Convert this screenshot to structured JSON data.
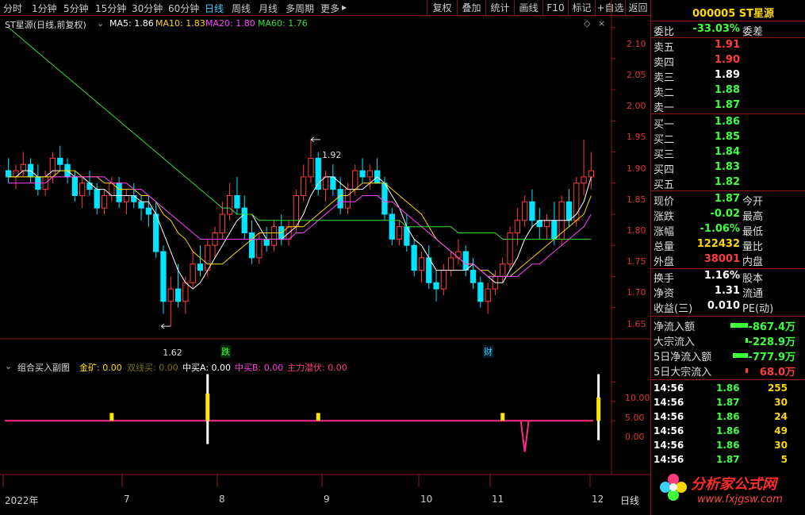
{
  "toolbar": {
    "timeframes": [
      "分时",
      "1分钟",
      "5分钟",
      "15分钟",
      "30分钟",
      "60分钟",
      "日线",
      "周线",
      "月线",
      "多周期",
      "更多"
    ],
    "active_timeframe": "日线",
    "more_arrow": "▸",
    "buttons": [
      "复权",
      "叠加",
      "统计",
      "画线",
      "F10",
      "标记",
      "+自选",
      "返回"
    ]
  },
  "main_legend": {
    "title": "ST星源(日线,前复权)",
    "ma5": "MA5: 1.86",
    "ma10": "MA10: 1.83",
    "ma20": "MA20: 1.80",
    "ma60": "MA60: 1.76",
    "ma5_color": "#ffffff",
    "ma10_color": "#ffd700",
    "ma20_color": "#ff44ff",
    "ma60_color": "#33dd33"
  },
  "annotations": {
    "high": "1.92",
    "low": "1.62",
    "mark_die": "跌",
    "mark_cai": "财"
  },
  "sub_legend": {
    "title": "组合买入副图",
    "jinkuang_label": "金矿: ",
    "jinkuang_value": "0.00",
    "shuangxian_label": "双线买: ",
    "shuangxian_value": "0.00",
    "zhongmai_a_label": "中买A: ",
    "zhongmai_a_value": "0.00",
    "zhongmai_b_label": "中买B: ",
    "zhongmai_b_value": "0.00",
    "zhuli_label": "主力潜伏: ",
    "zhuli_value": "0.00"
  },
  "x_axis": [
    "2022年",
    "7",
    "8",
    "9",
    "10",
    "11",
    "12"
  ],
  "period_label": "日线",
  "chart_data": [
    {
      "type": "candlestick",
      "title": "ST星源(日线,前复权)",
      "ylim": [
        1.61,
        2.12
      ],
      "yticks": [
        "2.10",
        "2.05",
        "2.00",
        "1.95",
        "1.90",
        "1.85",
        "1.80",
        "1.75",
        "1.70",
        "1.65"
      ],
      "ytick_values": [
        2.1,
        2.05,
        2.0,
        1.95,
        1.9,
        1.85,
        1.8,
        1.75,
        1.7,
        1.65
      ],
      "candles": [
        [
          1.87,
          1.89,
          1.85,
          1.86
        ],
        [
          1.86,
          1.88,
          1.84,
          1.87
        ],
        [
          1.87,
          1.9,
          1.86,
          1.88
        ],
        [
          1.88,
          1.89,
          1.85,
          1.86
        ],
        [
          1.86,
          1.88,
          1.83,
          1.84
        ],
        [
          1.84,
          1.87,
          1.83,
          1.86
        ],
        [
          1.86,
          1.9,
          1.85,
          1.89
        ],
        [
          1.89,
          1.91,
          1.87,
          1.88
        ],
        [
          1.88,
          1.89,
          1.85,
          1.86
        ],
        [
          1.86,
          1.87,
          1.82,
          1.83
        ],
        [
          1.83,
          1.86,
          1.81,
          1.85
        ],
        [
          1.85,
          1.87,
          1.83,
          1.84
        ],
        [
          1.84,
          1.85,
          1.8,
          1.81
        ],
        [
          1.81,
          1.84,
          1.8,
          1.83
        ],
        [
          1.83,
          1.86,
          1.82,
          1.85
        ],
        [
          1.85,
          1.86,
          1.81,
          1.82
        ],
        [
          1.82,
          1.84,
          1.8,
          1.83
        ],
        [
          1.83,
          1.85,
          1.81,
          1.82
        ],
        [
          1.82,
          1.83,
          1.79,
          1.81
        ],
        [
          1.81,
          1.83,
          1.78,
          1.8
        ],
        [
          1.8,
          1.82,
          1.73,
          1.74
        ],
        [
          1.74,
          1.75,
          1.64,
          1.66
        ],
        [
          1.66,
          1.7,
          1.62,
          1.68
        ],
        [
          1.68,
          1.72,
          1.65,
          1.66
        ],
        [
          1.66,
          1.7,
          1.64,
          1.69
        ],
        [
          1.69,
          1.74,
          1.68,
          1.72
        ],
        [
          1.72,
          1.75,
          1.7,
          1.71
        ],
        [
          1.71,
          1.76,
          1.7,
          1.75
        ],
        [
          1.75,
          1.78,
          1.73,
          1.77
        ],
        [
          1.77,
          1.82,
          1.76,
          1.8
        ],
        [
          1.8,
          1.85,
          1.79,
          1.83
        ],
        [
          1.83,
          1.86,
          1.8,
          1.81
        ],
        [
          1.81,
          1.83,
          1.76,
          1.77
        ],
        [
          1.77,
          1.79,
          1.72,
          1.73
        ],
        [
          1.73,
          1.77,
          1.72,
          1.76
        ],
        [
          1.76,
          1.78,
          1.74,
          1.75
        ],
        [
          1.75,
          1.79,
          1.74,
          1.78
        ],
        [
          1.78,
          1.8,
          1.75,
          1.76
        ],
        [
          1.76,
          1.79,
          1.75,
          1.78
        ],
        [
          1.78,
          1.84,
          1.77,
          1.83
        ],
        [
          1.83,
          1.88,
          1.82,
          1.86
        ],
        [
          1.86,
          1.92,
          1.85,
          1.89
        ],
        [
          1.89,
          1.9,
          1.83,
          1.84
        ],
        [
          1.84,
          1.87,
          1.82,
          1.86
        ],
        [
          1.86,
          1.88,
          1.83,
          1.84
        ],
        [
          1.84,
          1.86,
          1.8,
          1.81
        ],
        [
          1.81,
          1.85,
          1.8,
          1.84
        ],
        [
          1.84,
          1.88,
          1.83,
          1.87
        ],
        [
          1.87,
          1.89,
          1.85,
          1.86
        ],
        [
          1.86,
          1.88,
          1.84,
          1.87
        ],
        [
          1.87,
          1.89,
          1.85,
          1.85
        ],
        [
          1.85,
          1.86,
          1.79,
          1.8
        ],
        [
          1.8,
          1.81,
          1.75,
          1.76
        ],
        [
          1.76,
          1.79,
          1.75,
          1.78
        ],
        [
          1.78,
          1.8,
          1.74,
          1.75
        ],
        [
          1.75,
          1.76,
          1.7,
          1.71
        ],
        [
          1.71,
          1.74,
          1.69,
          1.73
        ],
        [
          1.73,
          1.75,
          1.68,
          1.69
        ],
        [
          1.69,
          1.71,
          1.66,
          1.68
        ],
        [
          1.68,
          1.72,
          1.67,
          1.71
        ],
        [
          1.71,
          1.74,
          1.7,
          1.73
        ],
        [
          1.73,
          1.76,
          1.72,
          1.74
        ],
        [
          1.74,
          1.75,
          1.7,
          1.71
        ],
        [
          1.71,
          1.73,
          1.68,
          1.69
        ],
        [
          1.69,
          1.7,
          1.65,
          1.66
        ],
        [
          1.66,
          1.69,
          1.64,
          1.68
        ],
        [
          1.68,
          1.71,
          1.67,
          1.7
        ],
        [
          1.7,
          1.73,
          1.69,
          1.72
        ],
        [
          1.72,
          1.78,
          1.71,
          1.77
        ],
        [
          1.77,
          1.81,
          1.75,
          1.79
        ],
        [
          1.79,
          1.83,
          1.78,
          1.82
        ],
        [
          1.82,
          1.84,
          1.78,
          1.79
        ],
        [
          1.79,
          1.81,
          1.76,
          1.78
        ],
        [
          1.78,
          1.8,
          1.76,
          1.79
        ],
        [
          1.79,
          1.82,
          1.75,
          1.76
        ],
        [
          1.76,
          1.83,
          1.75,
          1.82
        ],
        [
          1.82,
          1.84,
          1.78,
          1.79
        ],
        [
          1.79,
          1.86,
          1.78,
          1.85
        ],
        [
          1.85,
          1.92,
          1.83,
          1.86
        ],
        [
          1.86,
          1.9,
          1.84,
          1.87
        ]
      ],
      "series": [
        {
          "name": "MA5",
          "values": [
            1.86,
            1.86,
            1.87,
            1.87,
            1.86,
            1.86,
            1.87,
            1.87,
            1.87,
            1.86,
            1.86,
            1.85,
            1.84,
            1.84,
            1.83,
            1.83,
            1.83,
            1.83,
            1.82,
            1.82,
            1.8,
            1.77,
            1.74,
            1.71,
            1.69,
            1.68,
            1.69,
            1.71,
            1.73,
            1.75,
            1.77,
            1.79,
            1.8,
            1.8,
            1.78,
            1.76,
            1.76,
            1.76,
            1.77,
            1.78,
            1.8,
            1.83,
            1.85,
            1.86,
            1.86,
            1.85,
            1.84,
            1.84,
            1.84,
            1.85,
            1.86,
            1.85,
            1.83,
            1.81,
            1.78,
            1.76,
            1.75,
            1.73,
            1.71,
            1.71,
            1.71,
            1.71,
            1.71,
            1.72,
            1.71,
            1.7,
            1.69,
            1.69,
            1.71,
            1.73,
            1.76,
            1.78,
            1.79,
            1.79,
            1.79,
            1.79,
            1.79,
            1.8,
            1.82,
            1.86
          ]
        },
        {
          "name": "MA10",
          "values": [
            1.86,
            1.86,
            1.86,
            1.86,
            1.86,
            1.86,
            1.86,
            1.87,
            1.87,
            1.87,
            1.86,
            1.86,
            1.86,
            1.85,
            1.85,
            1.84,
            1.84,
            1.84,
            1.83,
            1.83,
            1.82,
            1.8,
            1.79,
            1.77,
            1.76,
            1.74,
            1.73,
            1.72,
            1.72,
            1.72,
            1.73,
            1.74,
            1.75,
            1.76,
            1.77,
            1.77,
            1.77,
            1.77,
            1.78,
            1.78,
            1.78,
            1.79,
            1.8,
            1.81,
            1.82,
            1.83,
            1.83,
            1.84,
            1.85,
            1.85,
            1.85,
            1.85,
            1.84,
            1.83,
            1.82,
            1.81,
            1.8,
            1.78,
            1.76,
            1.75,
            1.74,
            1.73,
            1.72,
            1.72,
            1.71,
            1.71,
            1.7,
            1.7,
            1.7,
            1.71,
            1.72,
            1.73,
            1.74,
            1.75,
            1.76,
            1.77,
            1.78,
            1.79,
            1.8,
            1.83
          ]
        },
        {
          "name": "MA20",
          "values": [
            1.85,
            1.85,
            1.85,
            1.85,
            1.85,
            1.85,
            1.86,
            1.86,
            1.86,
            1.86,
            1.86,
            1.86,
            1.86,
            1.86,
            1.85,
            1.85,
            1.85,
            1.84,
            1.84,
            1.83,
            1.82,
            1.81,
            1.8,
            1.79,
            1.78,
            1.77,
            1.76,
            1.76,
            1.76,
            1.76,
            1.76,
            1.76,
            1.76,
            1.76,
            1.76,
            1.76,
            1.76,
            1.76,
            1.76,
            1.77,
            1.77,
            1.78,
            1.79,
            1.8,
            1.81,
            1.82,
            1.82,
            1.82,
            1.83,
            1.83,
            1.83,
            1.82,
            1.82,
            1.81,
            1.8,
            1.79,
            1.78,
            1.77,
            1.76,
            1.75,
            1.74,
            1.73,
            1.72,
            1.72,
            1.71,
            1.7,
            1.7,
            1.7,
            1.7,
            1.7,
            1.71,
            1.72,
            1.72,
            1.73,
            1.74,
            1.75,
            1.76,
            1.77,
            1.78,
            1.8
          ]
        },
        {
          "name": "MA60",
          "values": [
            2.1,
            2.09,
            2.08,
            2.07,
            2.06,
            2.05,
            2.04,
            2.03,
            2.02,
            2.01,
            2.0,
            1.99,
            1.98,
            1.97,
            1.96,
            1.95,
            1.94,
            1.93,
            1.92,
            1.91,
            1.9,
            1.89,
            1.88,
            1.87,
            1.86,
            1.85,
            1.84,
            1.83,
            1.82,
            1.81,
            1.81,
            1.8,
            1.8,
            1.8,
            1.79,
            1.79,
            1.79,
            1.79,
            1.79,
            1.79,
            1.79,
            1.79,
            1.79,
            1.79,
            1.79,
            1.79,
            1.79,
            1.79,
            1.79,
            1.79,
            1.79,
            1.79,
            1.79,
            1.79,
            1.78,
            1.78,
            1.78,
            1.78,
            1.78,
            1.78,
            1.78,
            1.77,
            1.77,
            1.77,
            1.77,
            1.77,
            1.77,
            1.76,
            1.76,
            1.76,
            1.76,
            1.76,
            1.76,
            1.76,
            1.76,
            1.76,
            1.76,
            1.76,
            1.76,
            1.76
          ]
        }
      ]
    },
    {
      "type": "bar",
      "title": "组合买入副图",
      "ylim": [
        -12,
        17
      ],
      "yticks": [
        "10.00",
        "5.00",
        "0.00"
      ],
      "ytick_values": [
        10,
        5,
        0
      ],
      "signals": [
        {
          "index": 14,
          "kind": "yellow",
          "bottom": 0,
          "top": 2
        },
        {
          "index": 27,
          "kind": "white",
          "bottom": -6,
          "top": 12
        },
        {
          "index": 27,
          "kind": "yellow",
          "bottom": 0,
          "top": 7
        },
        {
          "index": 42,
          "kind": "yellow",
          "bottom": 0,
          "top": 2
        },
        {
          "index": 67,
          "kind": "yellow",
          "bottom": 0,
          "top": 2
        },
        {
          "index": 70,
          "kind": "magenta-dip",
          "bottom": -8,
          "top": 0
        },
        {
          "index": 80,
          "kind": "white",
          "bottom": -5,
          "top": 12
        },
        {
          "index": 80,
          "kind": "yellow",
          "bottom": 0,
          "top": 6
        }
      ]
    }
  ],
  "panel": {
    "stock_title": "000005 ST星源",
    "weibi_label": "委比",
    "weibi_value": "-33.03%",
    "weicha_label": "委差",
    "sells": [
      {
        "label": "卖五",
        "price": "1.91"
      },
      {
        "label": "卖四",
        "price": "1.90"
      },
      {
        "label": "卖三",
        "price": "1.89"
      },
      {
        "label": "卖二",
        "price": "1.88"
      },
      {
        "label": "卖一",
        "price": "1.87"
      }
    ],
    "buys": [
      {
        "label": "买一",
        "price": "1.86"
      },
      {
        "label": "买二",
        "price": "1.85"
      },
      {
        "label": "买三",
        "price": "1.84"
      },
      {
        "label": "买四",
        "price": "1.83"
      },
      {
        "label": "买五",
        "price": "1.82"
      }
    ],
    "quote": [
      {
        "label": "现价",
        "value": "1.87",
        "label2": "今开"
      },
      {
        "label": "涨跌",
        "value": "-0.02",
        "label2": "最高"
      },
      {
        "label": "涨幅",
        "value": "-1.06%",
        "label2": "最低"
      },
      {
        "label": "总量",
        "value": "122432",
        "label2": "量比"
      },
      {
        "label": "外盘",
        "value": "38001",
        "label2": "内盘"
      }
    ],
    "stats": [
      {
        "label": "换手",
        "value": "1.16%",
        "label2": "股本"
      },
      {
        "label": "净资",
        "value": "1.31",
        "label2": "流通"
      },
      {
        "label": "收益(三)",
        "value": "0.010",
        "label2": "PE(动)"
      }
    ],
    "flows": [
      {
        "label": "净流入额",
        "value": "-867.4万",
        "bar": 0.9,
        "color": "green"
      },
      {
        "label": "大宗流入",
        "value": "-228.9万",
        "bar": 0.1,
        "color": "green"
      },
      {
        "label": "5日净流入额",
        "value": "-777.9万",
        "bar": 0.8,
        "color": "green"
      },
      {
        "label": "5日大宗流入",
        "value": "68.0万",
        "bar": 0.05,
        "color": "red"
      }
    ],
    "ticks": [
      {
        "time": "14:56",
        "price": "1.86",
        "vol": "255",
        "vcolor": "yellow"
      },
      {
        "time": "14:56",
        "price": "1.87",
        "vol": "30",
        "vcolor": "yellow"
      },
      {
        "time": "14:56",
        "price": "1.86",
        "vol": "24",
        "vcolor": "yellow"
      },
      {
        "time": "14:56",
        "price": "1.86",
        "vol": "49",
        "vcolor": "yellow"
      },
      {
        "time": "14:56",
        "price": "1.86",
        "vol": "30",
        "vcolor": "yellow"
      },
      {
        "time": "14:56",
        "price": "1.87",
        "vol": "5",
        "vcolor": "yellow"
      }
    ],
    "watermark_text": "分析家公式网",
    "watermark_url": "www.fxjgsw.com"
  }
}
